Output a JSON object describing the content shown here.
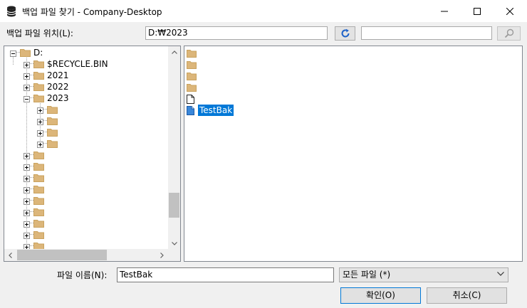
{
  "window": {
    "title": "백업 파일 찾기 - Company-Desktop",
    "app_icon": "database-icon",
    "controls": [
      "minimize-icon",
      "maximize-icon",
      "close-icon"
    ]
  },
  "location": {
    "label": "백업 파일 위치(L):",
    "value": "D:₩2023",
    "refresh_icon": "refresh-icon",
    "search_value": "",
    "search_icon": "search-icon"
  },
  "tree": {
    "items": [
      {
        "label": "D:",
        "expanded": true,
        "level": 0
      },
      {
        "label": "$RECYCLE.BIN",
        "expanded": false,
        "level": 1
      },
      {
        "label": "2021",
        "expanded": false,
        "level": 1
      },
      {
        "label": "2022",
        "expanded": false,
        "level": 1
      },
      {
        "label": "2023",
        "expanded": true,
        "level": 1
      },
      {
        "label": "",
        "expanded": false,
        "level": 2
      },
      {
        "label": "",
        "expanded": false,
        "level": 2
      },
      {
        "label": "",
        "expanded": false,
        "level": 2
      },
      {
        "label": "",
        "expanded": false,
        "level": 2
      },
      {
        "label": "",
        "expanded": false,
        "level": 1
      },
      {
        "label": "",
        "expanded": false,
        "level": 1
      },
      {
        "label": "",
        "expanded": false,
        "level": 1
      },
      {
        "label": "",
        "expanded": false,
        "level": 1
      },
      {
        "label": "",
        "expanded": false,
        "level": 1
      },
      {
        "label": "",
        "expanded": false,
        "level": 1
      },
      {
        "label": "",
        "expanded": false,
        "level": 1
      },
      {
        "label": "",
        "expanded": false,
        "level": 1
      },
      {
        "label": "",
        "expanded": false,
        "level": 1
      }
    ]
  },
  "files": {
    "items": [
      {
        "type": "folder",
        "label": ""
      },
      {
        "type": "folder",
        "label": ""
      },
      {
        "type": "folder",
        "label": ""
      },
      {
        "type": "folder",
        "label": ""
      },
      {
        "type": "file",
        "label": ""
      },
      {
        "type": "backup-file",
        "label": "TestBak",
        "selected": true
      }
    ]
  },
  "footer": {
    "filename_label": "파일 이름(N):",
    "filename_value": "TestBak",
    "filetype_value": "모든 파일 (*)",
    "ok_label": "확인(O)",
    "cancel_label": "취소(C)"
  },
  "colors": {
    "folder": "#dcb67a",
    "selection": "#0078d7",
    "accent": "#0078d7"
  }
}
